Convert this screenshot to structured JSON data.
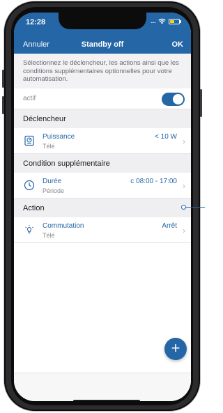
{
  "status_bar": {
    "time": "12:28",
    "signal": "....",
    "wifi_icon": "wifi-icon",
    "battery_icon": "battery-icon"
  },
  "nav": {
    "cancel": "Annuler",
    "title": "Standby off",
    "ok": "OK"
  },
  "description": "Sélectionnez le déclencheur, les actions ainsi que les conditions supplémentaires optionnelles pour votre automatisation.",
  "active": {
    "label": "actif",
    "toggle_on": true
  },
  "sections": {
    "trigger": "Déclencheur",
    "condition": "Condition supplémentaire",
    "action": "Action"
  },
  "items": {
    "trigger": {
      "title": "Puissance",
      "subtitle": "Télé",
      "value": "< 10 W",
      "icon": "power-meter-icon"
    },
    "condition": {
      "title": "Durée",
      "subtitle": "Période",
      "value": "08:00 - 17:00",
      "value_prefix": "c",
      "icon": "clock-icon"
    },
    "action": {
      "title": "Commutation",
      "subtitle": "Télé",
      "value": "Arrêt",
      "icon": "lightbulb-icon"
    }
  },
  "fab": {
    "label": "+",
    "icon": "plus-icon"
  },
  "colors": {
    "accent": "#2466a6",
    "section_bg": "#efeff2",
    "muted_text": "#8a8a8f"
  }
}
